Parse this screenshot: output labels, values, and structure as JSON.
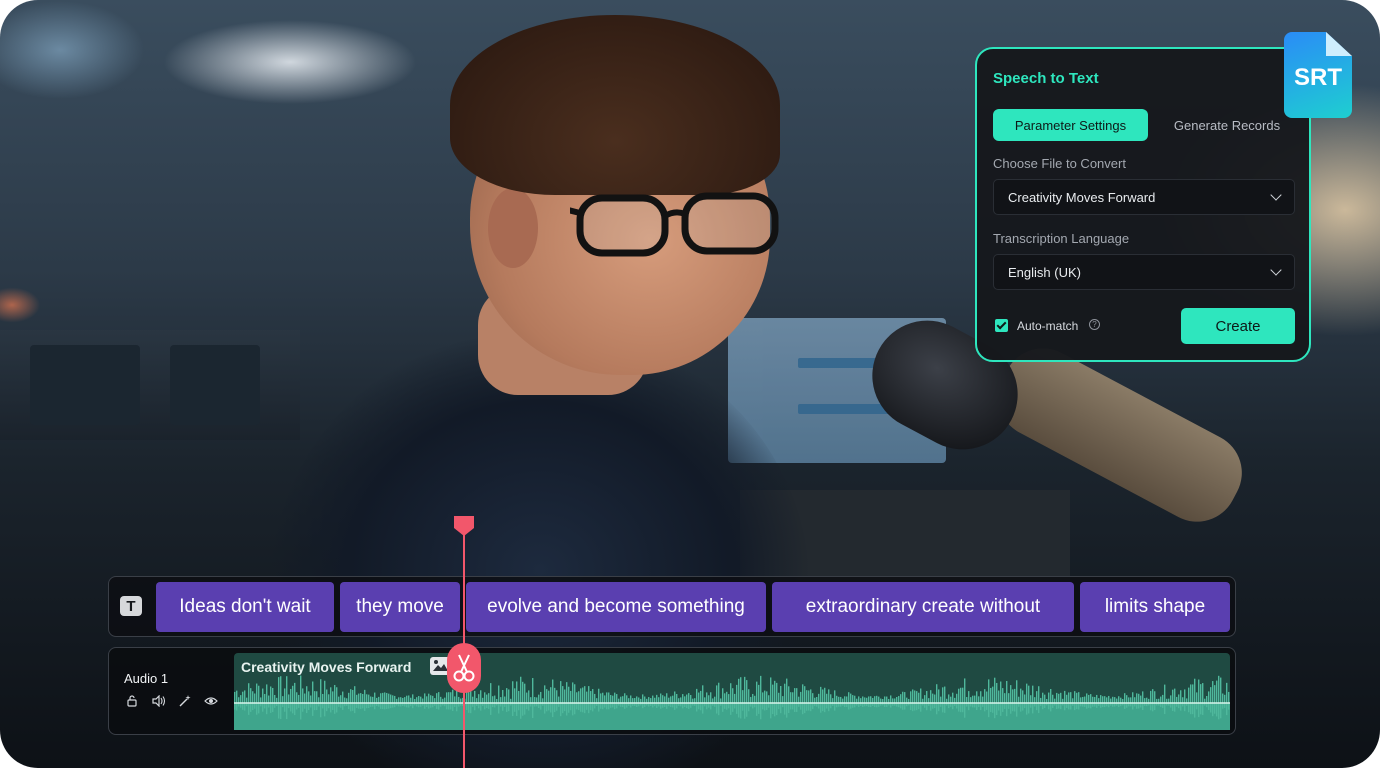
{
  "panel": {
    "title": "Speech to Text",
    "tabs": [
      {
        "label": "Parameter Settings",
        "active": true
      },
      {
        "label": "Generate Records",
        "active": false
      }
    ],
    "file_label": "Choose File to Convert",
    "file_value": "Creativity Moves Forward",
    "language_label": "Transcription Language",
    "language_value": "English (UK)",
    "auto_match_label": "Auto-match",
    "auto_match_checked": true,
    "create_label": "Create",
    "accent_color": "#2ee6be"
  },
  "file_badge": {
    "label": "SRT"
  },
  "timeline": {
    "caption_track_icon": "T",
    "captions": [
      "Ideas don't wait",
      "they move",
      "evolve and become something",
      "extraordinary create without",
      "limits shape"
    ],
    "caption_color": "#5a3fb0",
    "audio_track_label": "Audio 1",
    "audio_clip_title": "Creativity Moves Forward",
    "audio_controls": [
      "unlock-icon",
      "volume-icon",
      "effects-icon",
      "eye-icon"
    ],
    "playhead_color": "#f2576b"
  }
}
